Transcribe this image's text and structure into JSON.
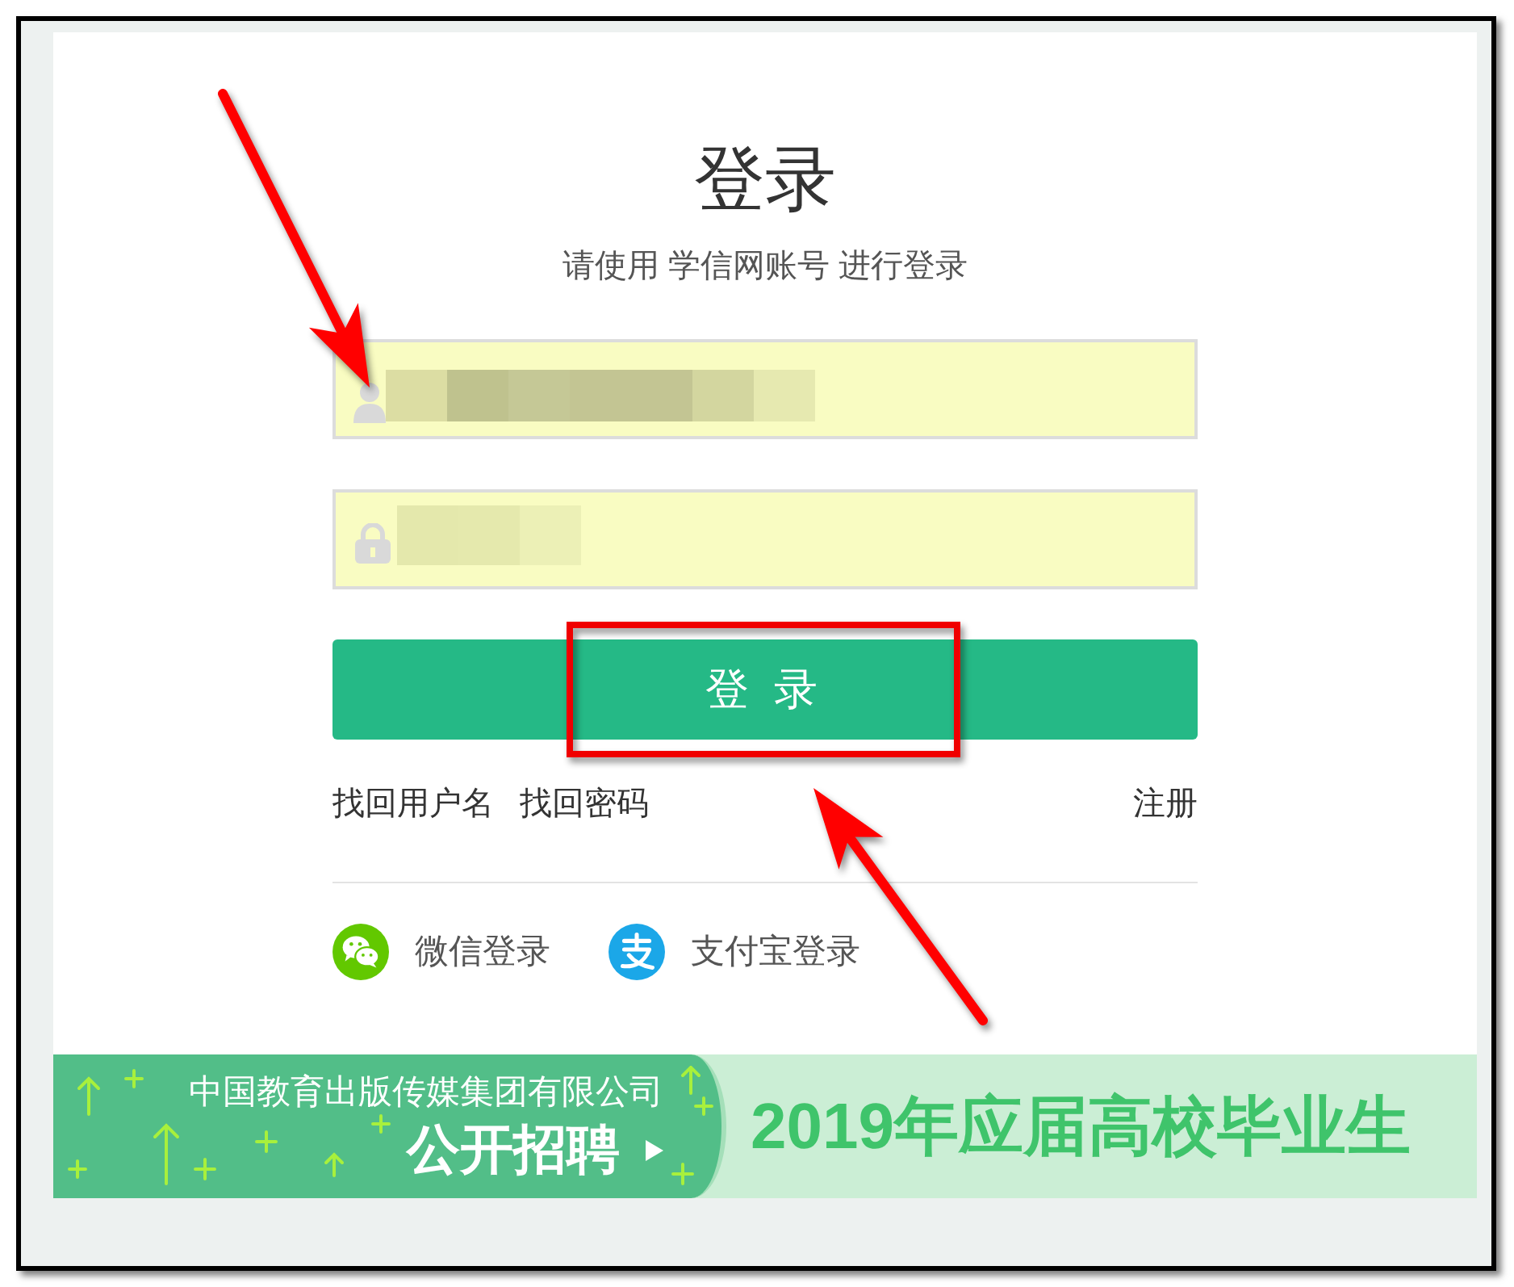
{
  "title": "登录",
  "subtitle": "请使用 学信网账号 进行登录",
  "username_field": {
    "autofilled": true,
    "value_obscured": true,
    "pointer_arrow": true
  },
  "password_field": {
    "autofilled": true,
    "value_obscured": true
  },
  "login_button": {
    "label": "登 录",
    "highlight_frame": true,
    "pointer_arrow": true
  },
  "links_left": [
    "找回用户名",
    "找回密码"
  ],
  "links_right": [
    "注册"
  ],
  "social_logins": [
    {
      "kind": "wechat",
      "label": "微信登录"
    },
    {
      "kind": "alipay",
      "label": "支付宝登录"
    }
  ],
  "banner": {
    "company": "中国教育出版传媒集团有限公司",
    "headline": "公开招聘",
    "tagline": "2019年应届高校毕业生"
  }
}
